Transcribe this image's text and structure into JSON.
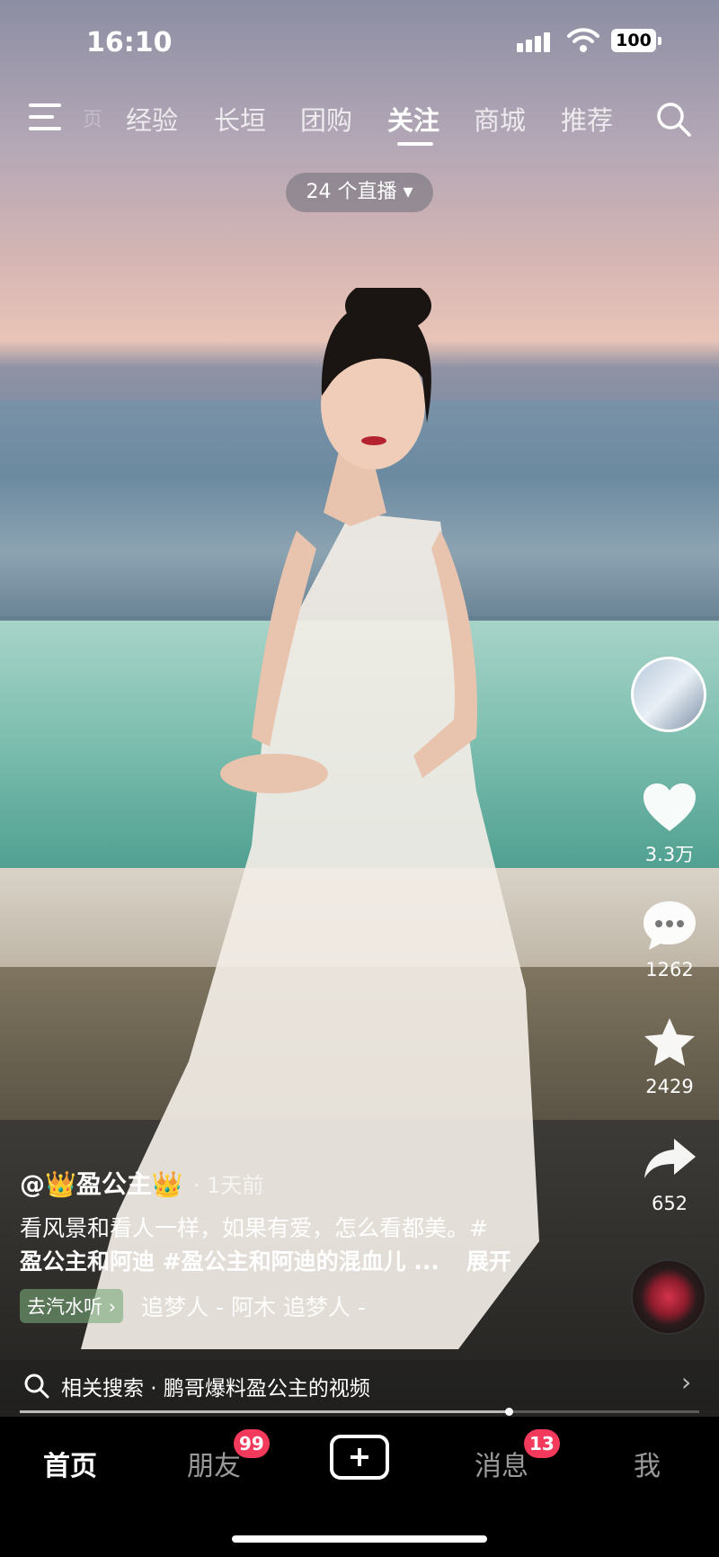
{
  "status": {
    "time": "16:10",
    "battery": "100"
  },
  "topnav": {
    "tabs": [
      {
        "label": "经验"
      },
      {
        "label": "长垣"
      },
      {
        "label": "团购"
      },
      {
        "label": "关注"
      },
      {
        "label": "商城"
      },
      {
        "label": "推荐"
      }
    ],
    "active_tab": "关注",
    "clipped_tab_glyph": "页"
  },
  "live_pill": "24 个直播 ▾",
  "rail": {
    "likes": "3.3万",
    "comments": "1262",
    "favorites": "2429",
    "shares": "652"
  },
  "post": {
    "author": "@👑盈公主👑",
    "time_ago": "· 1天前",
    "desc_line1": "看风景和看人一样，如果有爱，怎么看都美。#",
    "desc_line2": "盈公主和阿迪 #盈公主和阿迪的混血儿 ...",
    "expand": "展开",
    "go_tag": "去汽水听 ›",
    "music": "追梦人 - 阿木    追梦人 -"
  },
  "related": {
    "text": "相关搜索 · 鹏哥爆料盈公主的视频"
  },
  "progress": {
    "fraction": 0.72
  },
  "bottom_nav": {
    "home": "首页",
    "friends": "朋友",
    "friends_badge": "99",
    "messages": "消息",
    "messages_badge": "13",
    "me": "我"
  }
}
